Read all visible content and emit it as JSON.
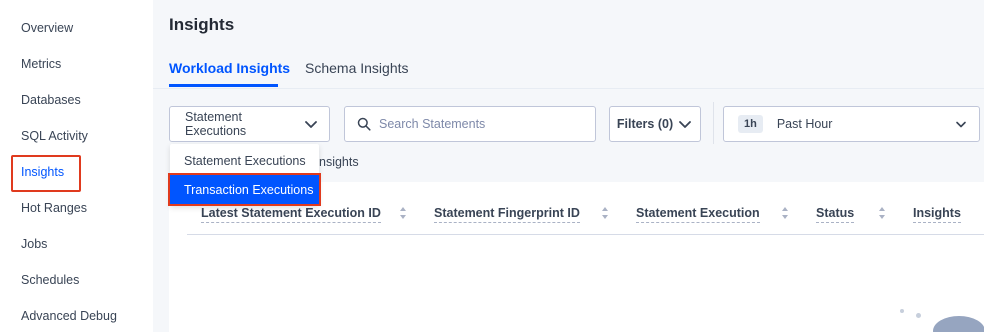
{
  "sidebar": {
    "items": [
      {
        "label": "Overview"
      },
      {
        "label": "Metrics"
      },
      {
        "label": "Databases"
      },
      {
        "label": "SQL Activity"
      },
      {
        "label": "Insights"
      },
      {
        "label": "Hot Ranges"
      },
      {
        "label": "Jobs"
      },
      {
        "label": "Schedules"
      },
      {
        "label": "Advanced Debug"
      }
    ],
    "active": "Insights"
  },
  "header": {
    "title": "Insights"
  },
  "tabs": [
    {
      "label": "Workload Insights",
      "active": true
    },
    {
      "label": "Schema Insights",
      "active": false
    }
  ],
  "toolbar": {
    "execution_type": "Statement Executions",
    "search_placeholder": "Search Statements",
    "filters_label": "Filters (0)",
    "time_badge": "1h",
    "time_label": "Past Hour"
  },
  "dropdown": {
    "options": [
      "Statement Executions",
      "Transaction Executions"
    ],
    "highlighted": "Transaction Executions"
  },
  "behind_dropdown_text": "nsights",
  "table": {
    "columns": [
      "Latest Statement Execution ID",
      "Statement Fingerprint ID",
      "Statement Execution",
      "Status",
      "Insights"
    ]
  },
  "colors": {
    "accent": "#0055ff",
    "highlight_box": "#e03a1e",
    "text": "#394455",
    "background": "#f5f7fa"
  },
  "icons": {
    "search": "search-icon",
    "chevron": "chevron-down-icon",
    "sort": "sort-icon"
  }
}
